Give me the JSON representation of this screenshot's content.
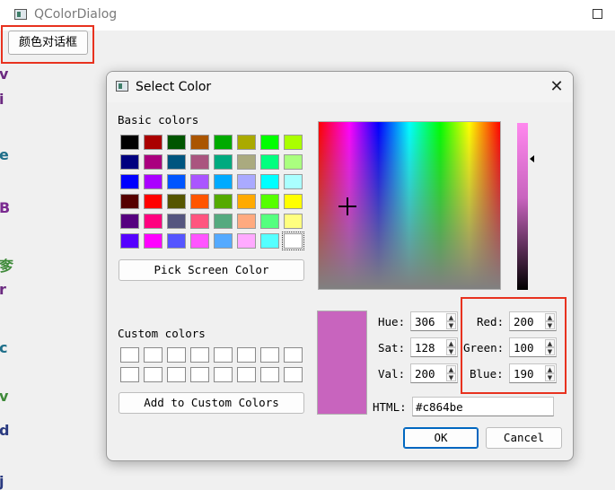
{
  "window": {
    "title": "QColorDialog"
  },
  "open_button": {
    "label": "颜色对话框"
  },
  "edge_fragments": [
    "v",
    "i",
    "e",
    "B",
    "奓",
    "r",
    "c",
    "v",
    "d",
    "j"
  ],
  "dialog": {
    "title": "Select Color",
    "close_glyph": "✕",
    "basic_colors_label": "Basic colors",
    "basic_colors": [
      [
        "#000000",
        "#aa0000",
        "#005500",
        "#aa5500",
        "#00aa00",
        "#aaaa00",
        "#00ff00",
        "#aaff00"
      ],
      [
        "#00007f",
        "#aa007f",
        "#00557f",
        "#aa557f",
        "#00aa7f",
        "#aaaa7f",
        "#00ff7f",
        "#aaff7f"
      ],
      [
        "#0000ff",
        "#aa00ff",
        "#0055ff",
        "#aa55ff",
        "#00aaff",
        "#aaaaff",
        "#00ffff",
        "#aaffff"
      ],
      [
        "#550000",
        "#ff0000",
        "#555500",
        "#ff5500",
        "#55aa00",
        "#ffaa00",
        "#55ff00",
        "#ffff00"
      ],
      [
        "#55007f",
        "#ff007f",
        "#55557f",
        "#ff557f",
        "#55aa7f",
        "#ffaa7f",
        "#55ff7f",
        "#ffff7f"
      ],
      [
        "#5500ff",
        "#ff00ff",
        "#5555ff",
        "#ff55ff",
        "#55aaff",
        "#ffaaff",
        "#55ffff",
        "#ffffff"
      ]
    ],
    "pick_screen_label": "Pick Screen Color",
    "custom_colors_label": "Custom colors",
    "add_custom_label": "Add to Custom Colors",
    "current_color": "#c864be",
    "fields": {
      "hue_label": "Hue:",
      "hue": "306",
      "sat_label": "Sat:",
      "sat": "128",
      "val_label": "Val:",
      "val": "200",
      "red_label": "Red:",
      "red": "200",
      "green_label": "Green:",
      "green": "100",
      "blue_label": "Blue:",
      "blue": "190",
      "html_label": "HTML:",
      "html": "#c864be"
    },
    "ok_label": "OK",
    "cancel_label": "Cancel"
  }
}
